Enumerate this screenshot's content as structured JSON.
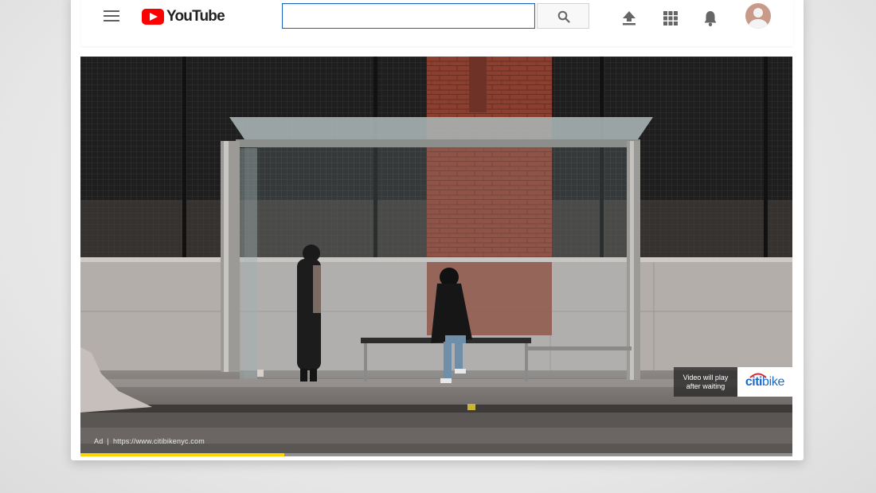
{
  "header": {
    "logo_text": "YouTube",
    "search": {
      "value": "",
      "placeholder": ""
    },
    "icons": [
      "menu-icon",
      "search-icon",
      "upload-icon",
      "apps-icon",
      "notifications-icon",
      "avatar"
    ]
  },
  "player": {
    "ad_label": "Ad",
    "ad_separator": "|",
    "ad_url": "https://www.citibikenyc.com",
    "countdown_line1": "Video will play",
    "countdown_line2": "after waiting",
    "sponsor_name_part1": "citi",
    "sponsor_name_part2": "bike",
    "progress_fraction": 0.286,
    "progress_color": "#fbd700"
  },
  "colors": {
    "brand_red": "#ff0000",
    "search_border": "#1c62b9",
    "sponsor_blue": "#1b6ac9"
  }
}
